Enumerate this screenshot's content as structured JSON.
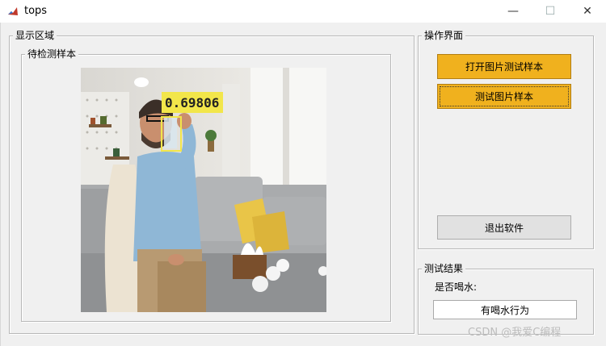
{
  "window": {
    "title": "tops",
    "min_symbol": "—",
    "max_symbol": "☐",
    "close_symbol": "✕"
  },
  "display_area": {
    "title": "显示区域",
    "sub_panel_title": "待检测样本",
    "detection": {
      "score_text": "0.69806",
      "box_color": "#f2e64a"
    }
  },
  "operation": {
    "title": "操作界面",
    "open_button": "打开图片测试样本",
    "test_button": "测试图片样本",
    "exit_button": "退出软件"
  },
  "results": {
    "title": "测试结果",
    "question_label": "是否喝水:",
    "answer": "有喝水行为"
  },
  "watermark": "CSDN @我爱C编程",
  "colors": {
    "accent_button": "#f0b11e",
    "window_bg": "#f0f0f0"
  }
}
